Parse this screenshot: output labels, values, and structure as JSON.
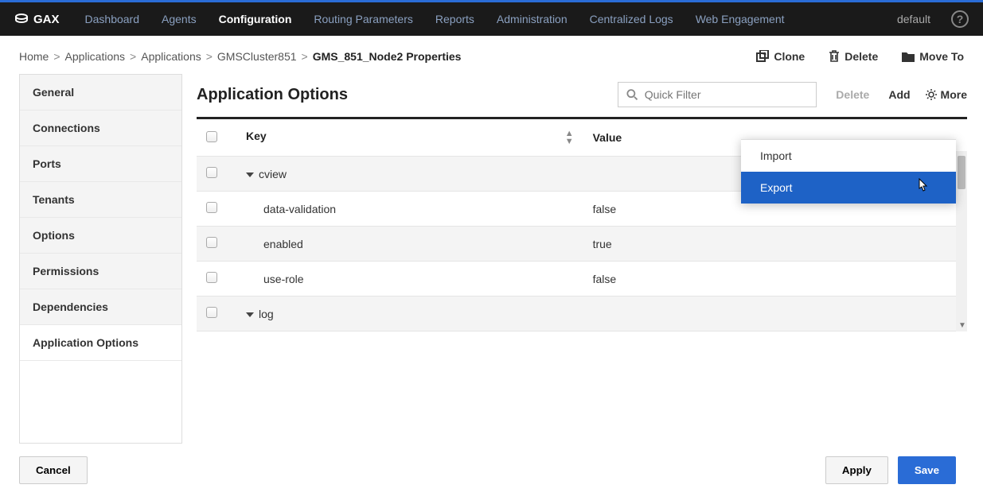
{
  "brand": "GAX",
  "nav": [
    {
      "label": "Dashboard",
      "active": false
    },
    {
      "label": "Agents",
      "active": false
    },
    {
      "label": "Configuration",
      "active": true
    },
    {
      "label": "Routing Parameters",
      "active": false
    },
    {
      "label": "Reports",
      "active": false
    },
    {
      "label": "Administration",
      "active": false
    },
    {
      "label": "Centralized Logs",
      "active": false
    },
    {
      "label": "Web Engagement",
      "active": false
    }
  ],
  "user_menu": "default",
  "breadcrumb": [
    "Home",
    "Applications",
    "Applications",
    "GMSCluster851",
    "GMS_851_Node2 Properties"
  ],
  "page_actions": {
    "clone": "Clone",
    "delete": "Delete",
    "move": "Move To"
  },
  "sidebar": {
    "items": [
      "General",
      "Connections",
      "Ports",
      "Tenants",
      "Options",
      "Permissions",
      "Dependencies",
      "Application Options"
    ],
    "active": "Application Options"
  },
  "main": {
    "title": "Application Options",
    "filter_placeholder": "Quick Filter",
    "tools": {
      "delete": "Delete",
      "add": "Add",
      "more": "More"
    },
    "columns": {
      "key": "Key",
      "value": "Value"
    },
    "rows": [
      {
        "type": "group",
        "key": "cview"
      },
      {
        "type": "row",
        "key": "data-validation",
        "value": "false"
      },
      {
        "type": "row",
        "key": "enabled",
        "value": "true"
      },
      {
        "type": "row",
        "key": "use-role",
        "value": "false"
      },
      {
        "type": "group",
        "key": "log"
      }
    ]
  },
  "dropdown": {
    "items": [
      "Import",
      "Export"
    ],
    "selected": "Export"
  },
  "footer": {
    "cancel": "Cancel",
    "apply": "Apply",
    "save": "Save"
  }
}
